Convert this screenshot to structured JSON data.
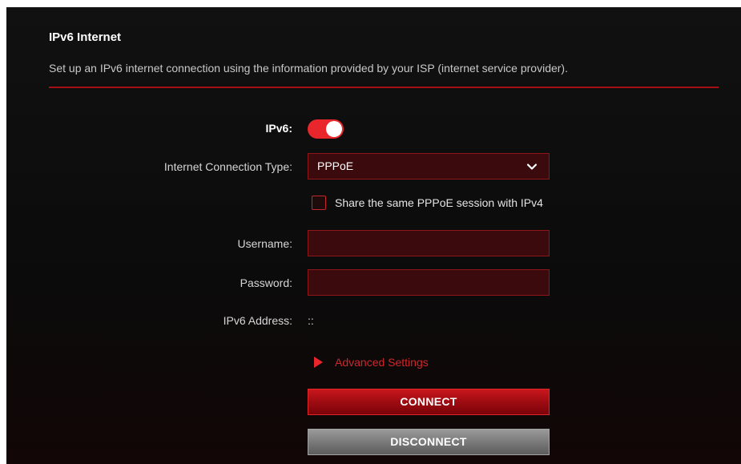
{
  "header": {
    "title": "IPv6 Internet",
    "description": "Set up an IPv6 internet connection using the information provided by your ISP (internet service provider)."
  },
  "form": {
    "ipv6_label": "IPv6:",
    "ipv6_enabled": true,
    "connection_type_label": "Internet Connection Type:",
    "connection_type_value": "PPPoE",
    "share_session_label": "Share the same PPPoE session with IPv4",
    "share_session_checked": false,
    "username_label": "Username:",
    "username_value": "",
    "password_label": "Password:",
    "password_value": "",
    "ipv6_address_label": "IPv6 Address:",
    "ipv6_address_value": "::",
    "advanced_settings_label": "Advanced Settings"
  },
  "buttons": {
    "connect_label": "CONNECT",
    "disconnect_label": "DISCONNECT"
  },
  "icons": {
    "toggle": "toggle-switch-icon",
    "dropdown": "chevron-down-icon",
    "expand": "triangle-right-icon"
  },
  "colors": {
    "accent": "#e8262b",
    "background": "#0e0e0e",
    "field_background": "#3a0a0c",
    "disconnect_button": "#7a7a7a"
  }
}
